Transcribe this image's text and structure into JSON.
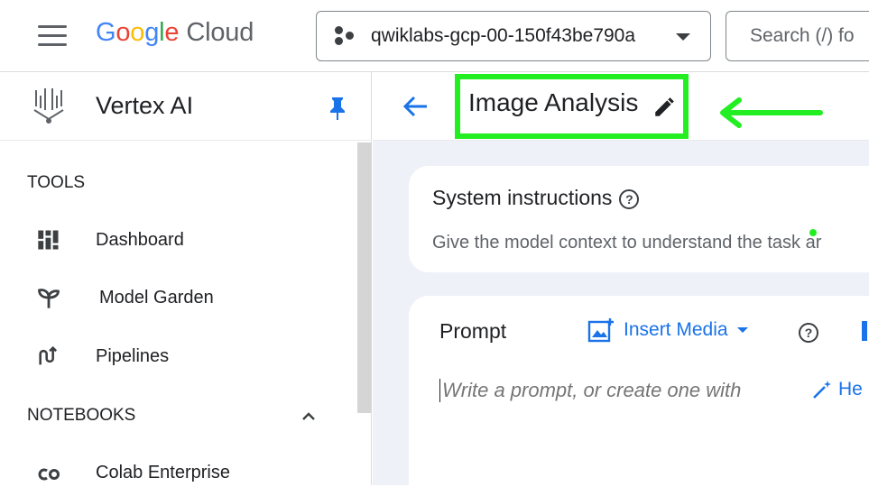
{
  "topbar": {
    "logo_google": [
      "G",
      "o",
      "o",
      "g",
      "l",
      "e"
    ],
    "logo_cloud": "Cloud",
    "project_name": "qwiklabs-gcp-00-150f43be790a",
    "search_placeholder": "Search (/) fo"
  },
  "sidebar": {
    "title": "Vertex AI",
    "sections": {
      "tools": "TOOLS",
      "notebooks": "NOTEBOOKS"
    },
    "items": [
      {
        "label": "Dashboard",
        "icon": "dashboard-icon"
      },
      {
        "label": "Model Garden",
        "icon": "model-garden-icon"
      },
      {
        "label": "Pipelines",
        "icon": "pipelines-icon"
      },
      {
        "label": "Colab Enterprise",
        "icon": "colab-icon"
      }
    ]
  },
  "main": {
    "page_title": "Image Analysis",
    "system_instructions": {
      "title": "System instructions",
      "description": "Give the model context to understand the task ar"
    },
    "prompt": {
      "label": "Prompt",
      "insert_media": "Insert Media",
      "placeholder": "Write a prompt, or create one with",
      "help_me": "He"
    }
  },
  "colors": {
    "accent": "#1a73e8",
    "highlight": "#22ee22",
    "background": "#eef1f7"
  }
}
